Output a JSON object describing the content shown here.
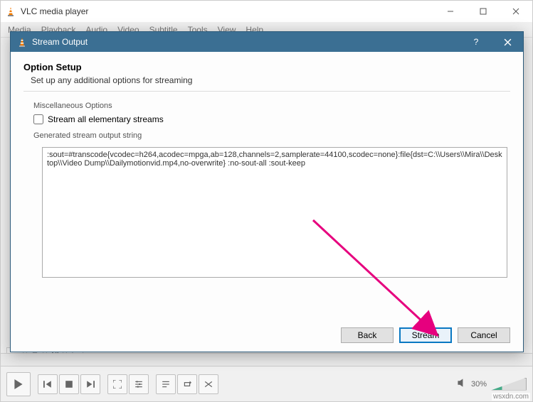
{
  "mainWindow": {
    "title": "VLC media player",
    "menu": [
      "Media",
      "Playback",
      "Audio",
      "Video",
      "Subtitle",
      "Tools",
      "View",
      "Help"
    ],
    "volume_pct": "30%"
  },
  "dialog": {
    "title": "Stream Output",
    "heading": "Option Setup",
    "description": "Set up any additional options for streaming",
    "misc": {
      "legend": "Miscellaneous Options",
      "checkbox_label": "Stream all elementary streams",
      "checked": false
    },
    "generated": {
      "legend": "Generated stream output string",
      "value": ":sout=#transcode{vcodec=h264,acodec=mpga,ab=128,channels=2,samplerate=44100,scodec=none}:file{dst=C:\\\\Users\\\\Mira\\\\Desktop\\\\Video Dump\\\\Dailymotionvid.mp4,no-overwrite} :no-sout-all :sout-keep"
    },
    "buttons": {
      "back": "Back",
      "stream": "Stream",
      "cancel": "Cancel"
    }
  },
  "watermark": "wsxdn.com"
}
